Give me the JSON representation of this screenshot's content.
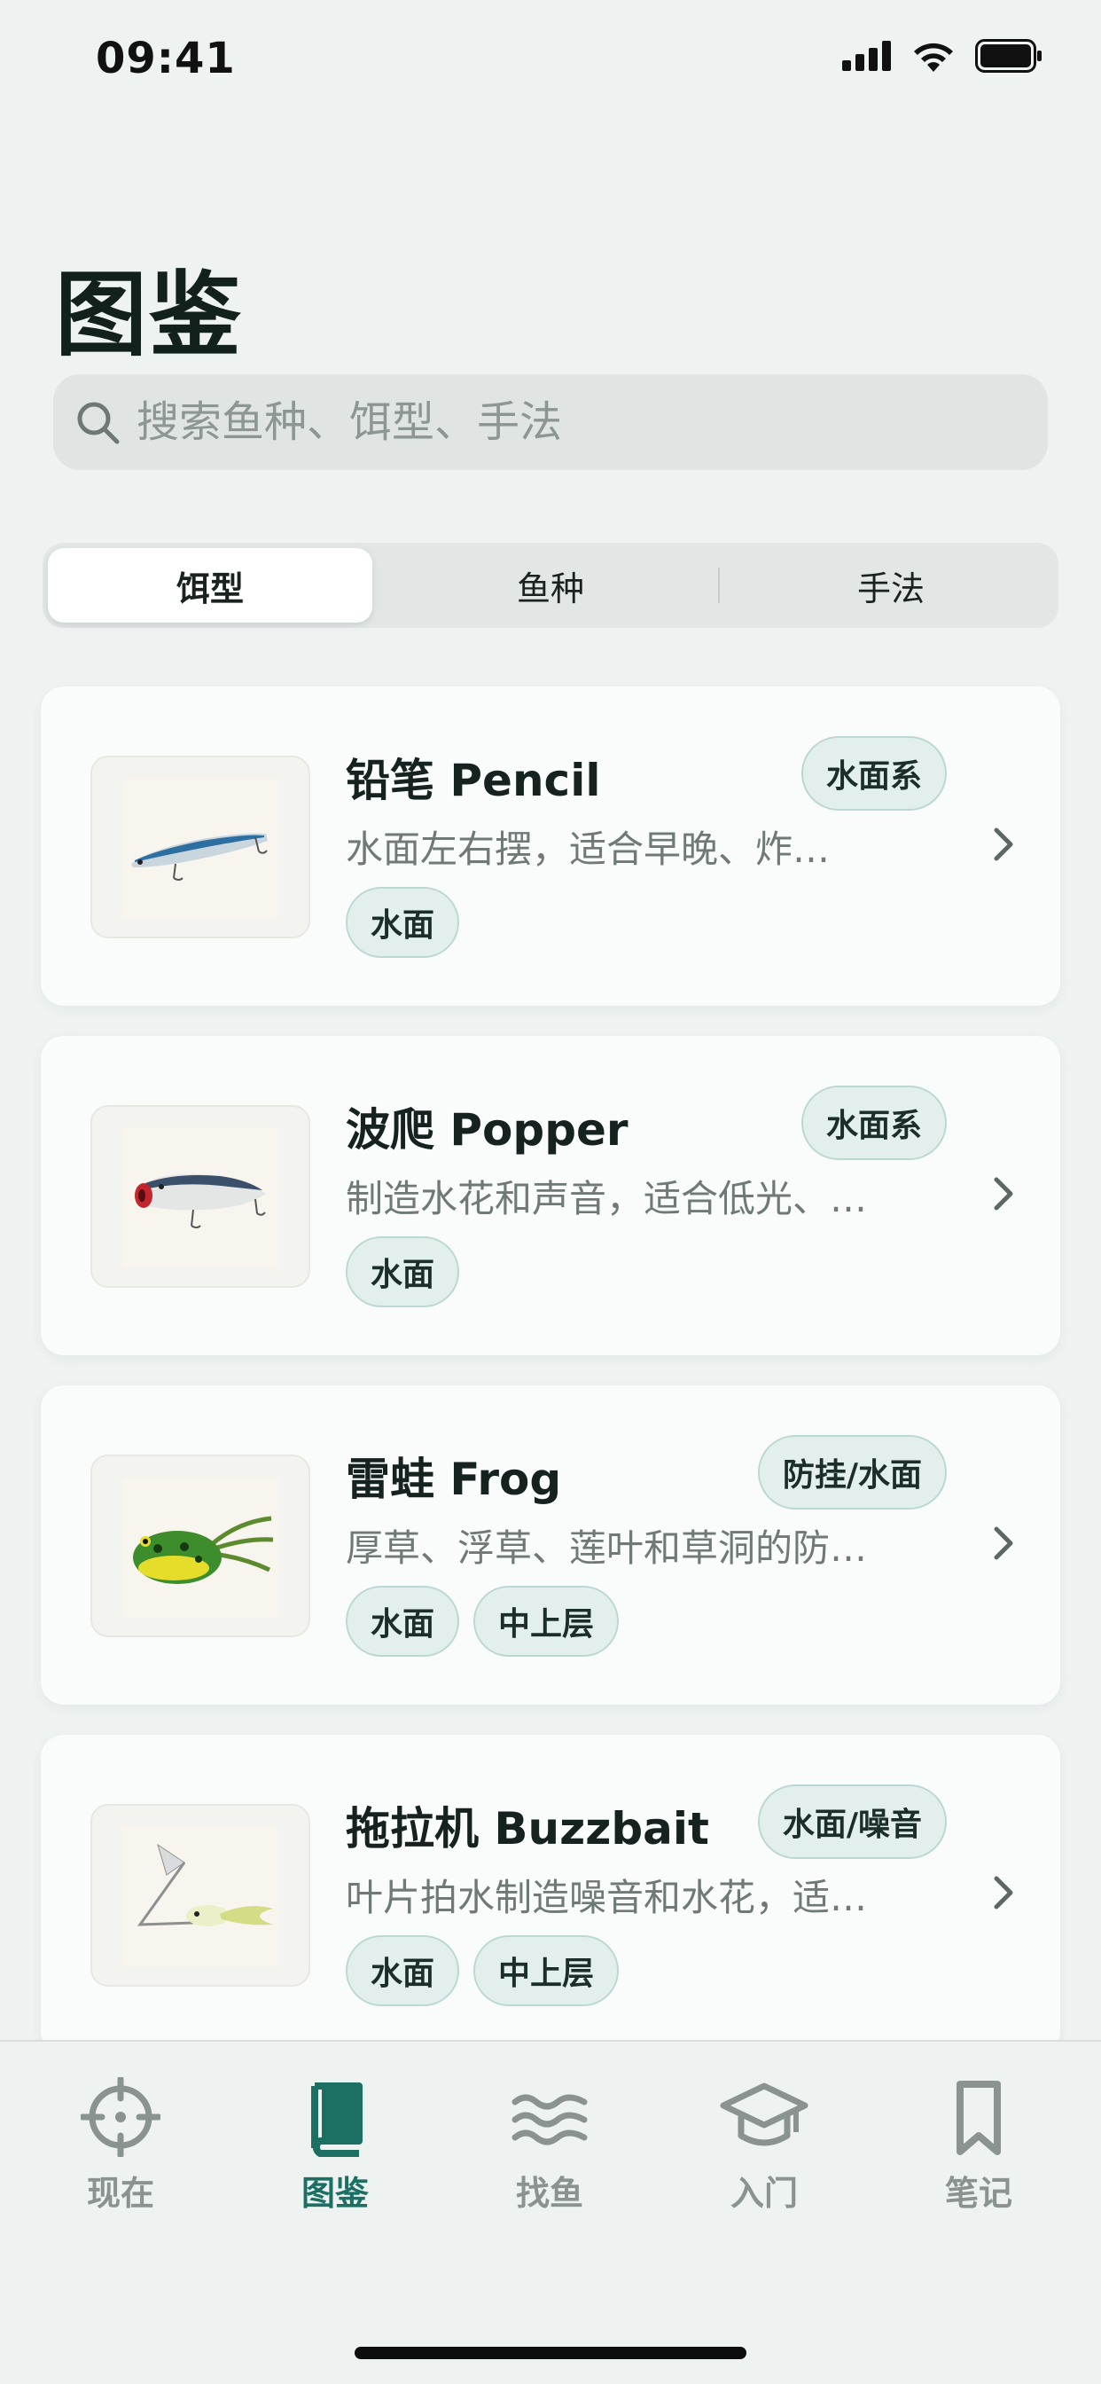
{
  "status_bar": {
    "time": "09:41"
  },
  "page": {
    "title": "图鉴"
  },
  "search": {
    "placeholder": "搜索鱼种、饵型、手法"
  },
  "segments": [
    {
      "label": "饵型",
      "active": true
    },
    {
      "label": "鱼种",
      "active": false
    },
    {
      "label": "手法",
      "active": false
    }
  ],
  "cards": [
    {
      "title": "铅笔 Pencil",
      "category": "水面系",
      "description": "水面左右摆，适合早晚、炸…",
      "tags": [
        "水面"
      ]
    },
    {
      "title": "波爬 Popper",
      "category": "水面系",
      "description": "制造水花和声音，适合低光、…",
      "tags": [
        "水面"
      ]
    },
    {
      "title": "雷蛙 Frog",
      "category": "防挂/水面",
      "description": "厚草、浮草、莲叶和草洞的防…",
      "tags": [
        "水面",
        "中上层"
      ]
    },
    {
      "title": "拖拉机 Buzzbait",
      "category": "水面/噪音",
      "description": "叶片拍水制造噪音和水花，适…",
      "tags": [
        "水面",
        "中上层"
      ]
    }
  ],
  "tab_bar": [
    {
      "label": "现在",
      "icon": "crosshair-icon",
      "active": false
    },
    {
      "label": "图鉴",
      "icon": "book-icon",
      "active": true
    },
    {
      "label": "找鱼",
      "icon": "waves-icon",
      "active": false
    },
    {
      "label": "入门",
      "icon": "graduation-cap-icon",
      "active": false
    },
    {
      "label": "笔记",
      "icon": "bookmark-icon",
      "active": false
    }
  ],
  "colors": {
    "accent": "#1b6f63",
    "inactive": "#8a9390",
    "badge_bg": "#e3efed",
    "badge_border": "#bcd8d3"
  }
}
